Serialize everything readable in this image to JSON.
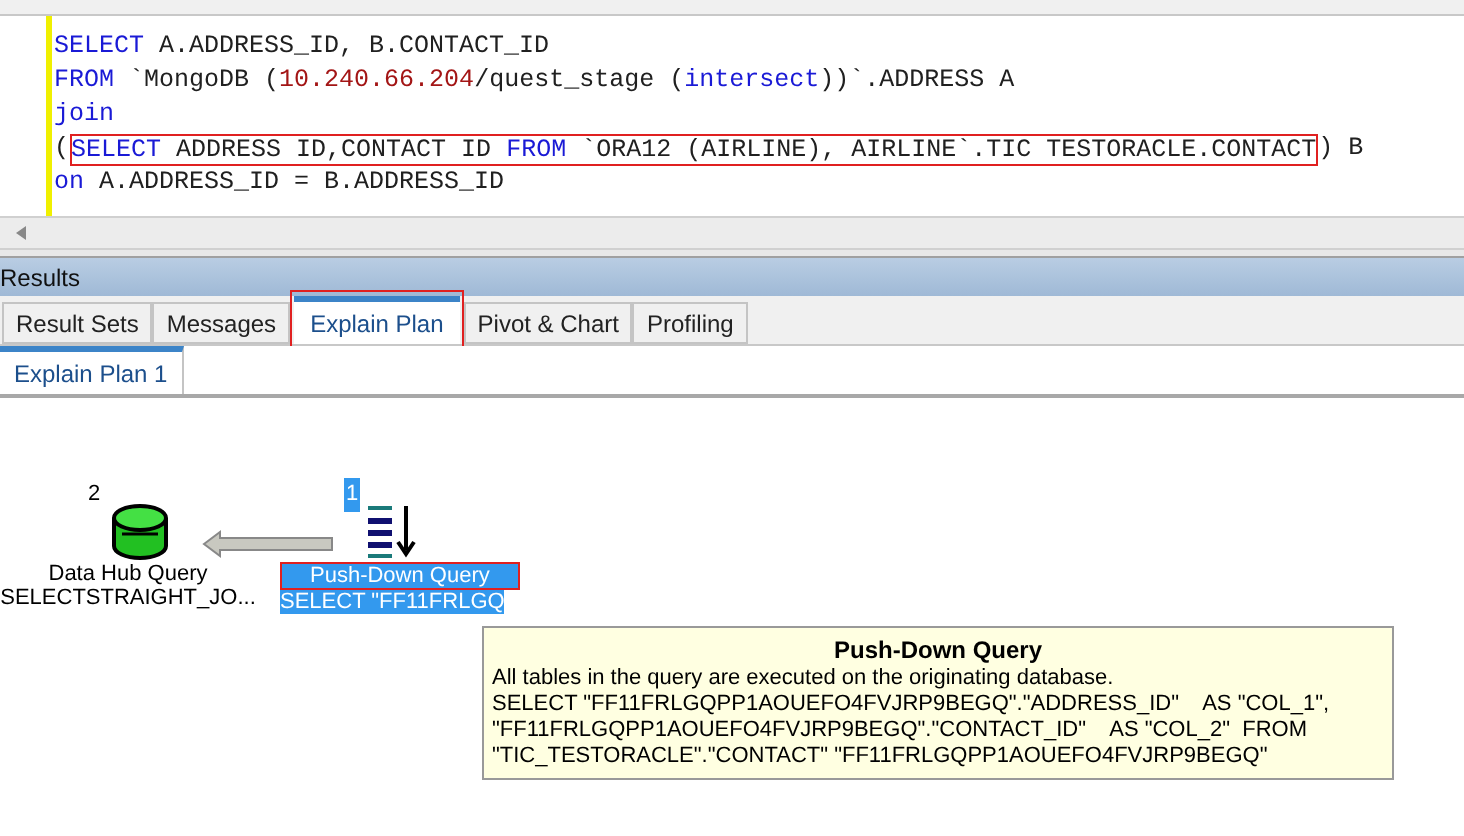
{
  "editor": {
    "lines": [
      {
        "tokens": [
          {
            "text": "SELECT",
            "kind": "keyword"
          },
          {
            "text": " A.ADDRESS_ID, B.CONTACT_ID",
            "kind": "plain"
          }
        ]
      },
      {
        "tokens": [
          {
            "text": "FROM",
            "kind": "keyword"
          },
          {
            "text": " `MongoDB (",
            "kind": "plain"
          },
          {
            "text": "10.240.66.204",
            "kind": "number"
          },
          {
            "text": "/quest_stage (",
            "kind": "plain"
          },
          {
            "text": "intersect",
            "kind": "keyword"
          },
          {
            "text": "))`.ADDRESS A",
            "kind": "plain"
          }
        ]
      },
      {
        "tokens": [
          {
            "text": "join",
            "kind": "keyword"
          }
        ]
      },
      {
        "tokens": [
          {
            "text": "(",
            "kind": "plain"
          },
          {
            "text": "SELECT",
            "kind": "keyword",
            "boxed": true
          },
          {
            "text": " ADDRESS ID,CONTACT ID ",
            "kind": "plain",
            "boxed": true
          },
          {
            "text": "FROM",
            "kind": "keyword",
            "boxed": true
          },
          {
            "text": " `ORA12 (AIRLINE), AIRLINE`.TIC TESTORACLE.CONTACT",
            "kind": "plain",
            "boxed": true
          },
          {
            "text": ") B",
            "kind": "plain"
          }
        ]
      },
      {
        "tokens": [
          {
            "text": "on",
            "kind": "keyword"
          },
          {
            "text": " A.ADDRESS_ID = B.ADDRESS_ID",
            "kind": "plain"
          }
        ]
      }
    ]
  },
  "results": {
    "title": "Results",
    "tabs": [
      {
        "label": "Result Sets",
        "selected": false,
        "boxed": false
      },
      {
        "label": "Messages",
        "selected": false,
        "boxed": false
      },
      {
        "label": "Explain Plan",
        "selected": true,
        "boxed": true
      },
      {
        "label": "Pivot & Chart",
        "selected": false,
        "boxed": false
      },
      {
        "label": "Profiling",
        "selected": false,
        "boxed": false
      }
    ],
    "subtabs": [
      {
        "label": "Explain Plan 1",
        "selected": true
      }
    ]
  },
  "plan": {
    "nodes": [
      {
        "kind": "datahub",
        "number": "2",
        "title": "Data Hub Query",
        "detail": "SELECTSTRAIGHT_JO...",
        "selected": false
      },
      {
        "kind": "pushdown",
        "number": "1",
        "title": "Push-Down Query",
        "detail": "SELECT \"FF11FRLGQ",
        "selected": true
      }
    ],
    "tooltip": {
      "title": "Push-Down Query",
      "lines": [
        "All tables in the query are executed on the originating database.",
        "SELECT \"FF11FRLGQPP1AOUEFO4FVJRP9BEGQ\".\"ADDRESS_ID\"    AS \"COL_1\",",
        "\"FF11FRLGQPP1AOUEFO4FVJRP9BEGQ\".\"CONTACT_ID\"    AS \"COL_2\"  FROM",
        "\"TIC_TESTORACLE\".\"CONTACT\" \"FF11FRLGQPP1AOUEFO4FVJRP9BEGQ\""
      ]
    }
  }
}
